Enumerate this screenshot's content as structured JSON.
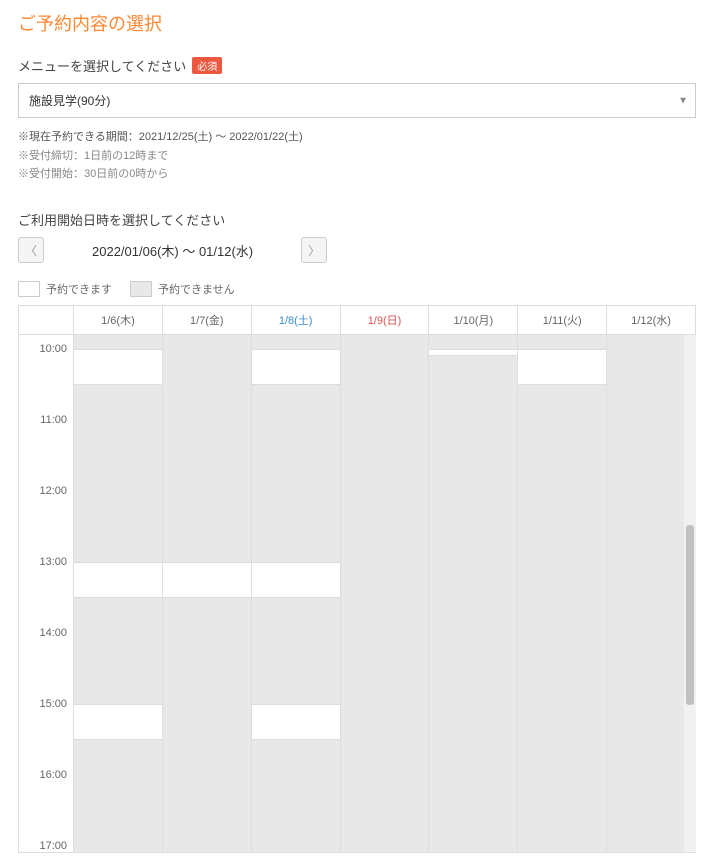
{
  "page_title": "ご予約内容の選択",
  "menu_label": "メニューを選択してください",
  "required_badge": "必須",
  "selected_menu": "施設見学(90分)",
  "notes": {
    "line1": "※現在予約できる期間：2021/12/25(土) 〜 2022/01/22(土)",
    "line2": "※受付締切：1日前の12時まで",
    "line3": "※受付開始：30日前の0時から"
  },
  "date_label": "ご利用開始日時を選択してください",
  "date_range": "2022/01/06(木) 〜 01/12(水)",
  "legend": {
    "available": "予約できます",
    "unavailable": "予約できません"
  },
  "time_ticks": [
    "10:00",
    "11:00",
    "12:00",
    "13:00",
    "14:00",
    "15:00",
    "16:00",
    "17:00"
  ],
  "days": [
    {
      "label": "1/6(木)",
      "type": "weekday"
    },
    {
      "label": "1/7(金)",
      "type": "weekday"
    },
    {
      "label": "1/8(土)",
      "type": "sat"
    },
    {
      "label": "1/9(日)",
      "type": "sun"
    },
    {
      "label": "1/10(月)",
      "type": "weekday"
    },
    {
      "label": "1/11(火)",
      "type": "weekday"
    },
    {
      "label": "1/12(水)",
      "type": "weekday"
    }
  ],
  "hour_height": 71,
  "start_hour": 9.8,
  "available_slots": [
    {
      "day": 0,
      "start": 10.0,
      "end": 10.5
    },
    {
      "day": 0,
      "start": 13.0,
      "end": 13.5
    },
    {
      "day": 0,
      "start": 15.0,
      "end": 15.5
    },
    {
      "day": 1,
      "start": 13.0,
      "end": 13.5
    },
    {
      "day": 2,
      "start": 10.0,
      "end": 10.5
    },
    {
      "day": 2,
      "start": 13.0,
      "end": 13.5
    },
    {
      "day": 2,
      "start": 15.0,
      "end": 15.5
    },
    {
      "day": 4,
      "start": 10.0,
      "end": 10.1
    },
    {
      "day": 5,
      "start": 10.0,
      "end": 10.5
    }
  ]
}
